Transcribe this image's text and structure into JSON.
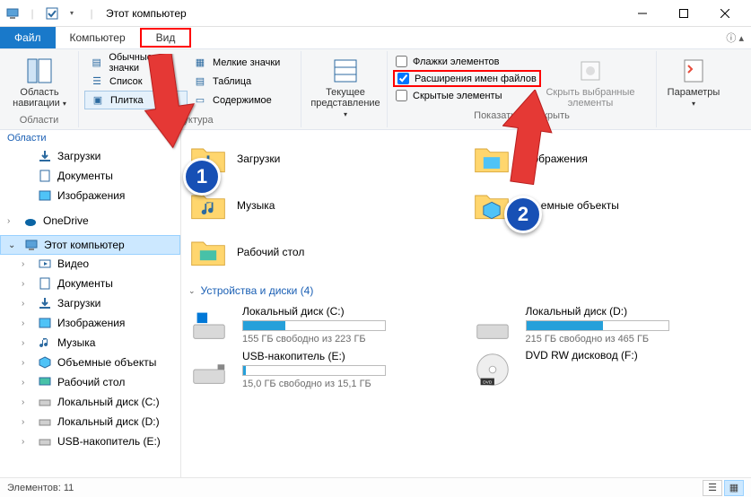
{
  "window": {
    "title": "Этот компьютер"
  },
  "tabs": {
    "file": "Файл",
    "computer": "Компьютер",
    "view": "Вид"
  },
  "ribbon": {
    "nav_panel": {
      "line1": "Область",
      "line2": "навигации",
      "group": "Области"
    },
    "layouts": {
      "regular": "Обычные значки",
      "small": "Мелкие значки",
      "list": "Список",
      "table": "Таблица",
      "tiles": "Плитка",
      "content": "Содержимое",
      "group": "Структура"
    },
    "current_view": {
      "line1": "Текущее",
      "line2": "представление"
    },
    "show_hide": {
      "item_checkboxes": "Флажки элементов",
      "extensions": "Расширения имен файлов",
      "hidden_items": "Скрытые элементы",
      "hide_selected": {
        "line1": "Скрыть выбранные",
        "line2": "элементы"
      },
      "group": "Показать или скрыть"
    },
    "options": "Параметры"
  },
  "sidebar": {
    "heading": "Области",
    "items": [
      {
        "label": "Загрузки"
      },
      {
        "label": "Документы"
      },
      {
        "label": "Изображения"
      },
      {
        "label": "OneDrive"
      },
      {
        "label": "Этот компьютер"
      },
      {
        "label": "Видео"
      },
      {
        "label": "Документы"
      },
      {
        "label": "Загрузки"
      },
      {
        "label": "Изображения"
      },
      {
        "label": "Музыка"
      },
      {
        "label": "Объемные объекты"
      },
      {
        "label": "Рабочий стол"
      },
      {
        "label": "Локальный диск (C:)"
      },
      {
        "label": "Локальный диск (D:)"
      },
      {
        "label": "USB-накопитель (E:)"
      }
    ]
  },
  "content": {
    "folders": [
      {
        "label": "Загрузки"
      },
      {
        "label": "Изображения"
      },
      {
        "label": "Музыка"
      },
      {
        "label": "Объемные объекты"
      },
      {
        "label": "Рабочий стол"
      }
    ],
    "section": "Устройства и диски (4)",
    "drives": [
      {
        "name": "Локальный диск (C:)",
        "free": "155 ГБ свободно из 223 ГБ",
        "pct": 30
      },
      {
        "name": "Локальный диск (D:)",
        "free": "215 ГБ свободно из 465 ГБ",
        "pct": 54
      },
      {
        "name": "USB-накопитель (E:)",
        "free": "15,0 ГБ свободно из 15,1 ГБ",
        "pct": 2
      },
      {
        "name": "DVD RW дисковод (F:)",
        "free": "",
        "pct": null
      }
    ]
  },
  "status": {
    "count": "Элементов: 11"
  },
  "annotations": {
    "one": "1",
    "two": "2"
  }
}
